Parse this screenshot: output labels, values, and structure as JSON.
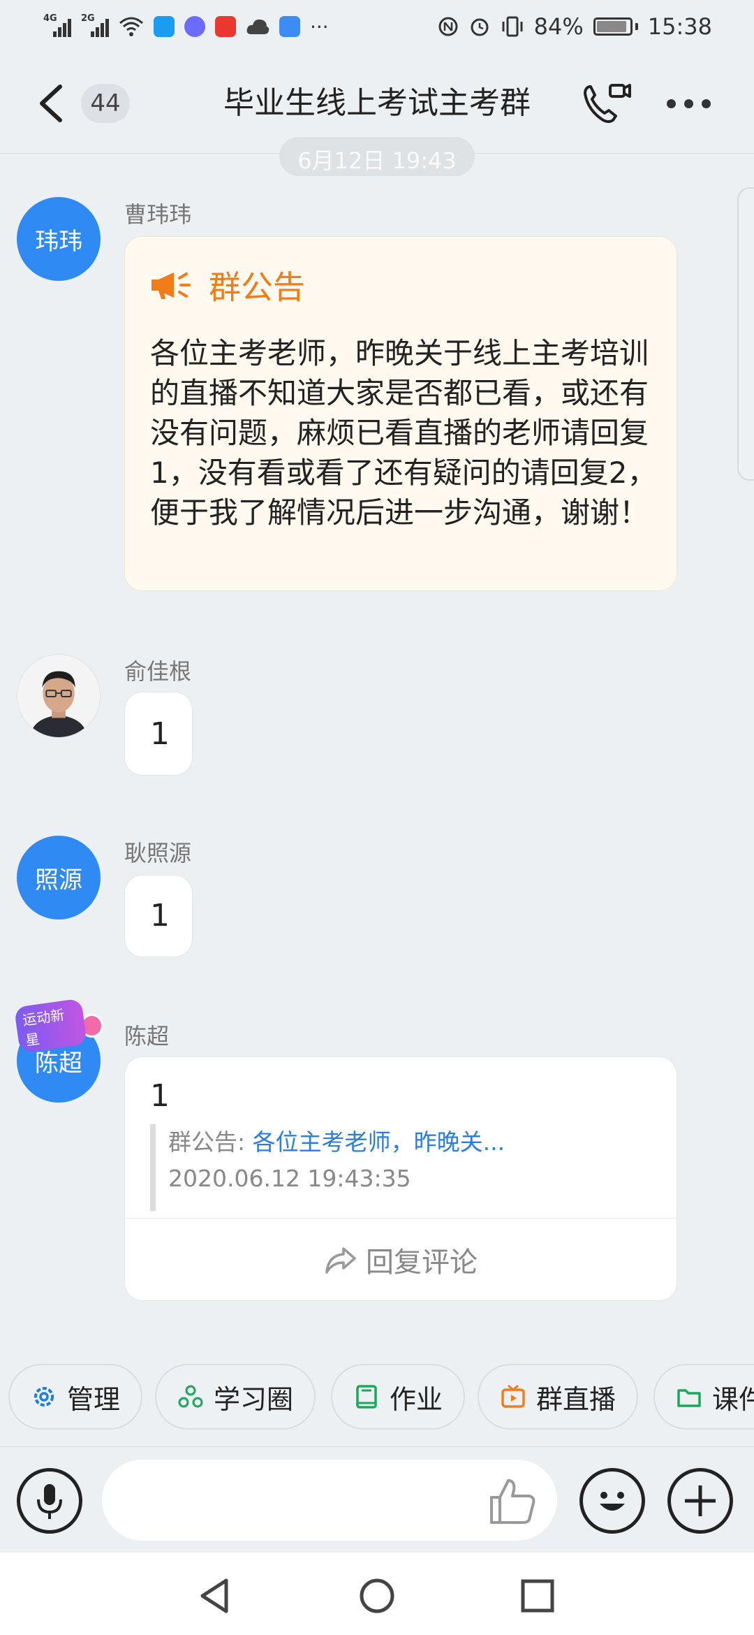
{
  "status_bar": {
    "net1": "4G",
    "net2": "2G",
    "battery": "84%",
    "time": "15:38",
    "extra": "···"
  },
  "header": {
    "back_icon": "chevron-left-icon",
    "unread_count": "44",
    "title": "毕业生线上考试主考群",
    "call_icon": "phone-video-icon",
    "more_icon": "more-dots-icon"
  },
  "time_divider": "6月12日 19:43",
  "messages": [
    {
      "avatar_text": "玮玮",
      "sender": "曹玮玮",
      "type": "notice",
      "notice_title": "群公告",
      "notice_icon": "megaphone-icon",
      "notice_body": "各位主考老师，昨晚关于线上主考培训的直播不知道大家是否都已看，或还有没有问题，麻烦已看直播的老师请回复1，没有看或看了还有疑问的请回复2，便于我了解情况后进一步沟通，谢谢！"
    },
    {
      "avatar_text": "",
      "sender": "俞佳根",
      "type": "text",
      "text": "1"
    },
    {
      "avatar_text": "照源",
      "sender": "耿照源",
      "type": "text",
      "text": "1"
    },
    {
      "avatar_text": "陈超",
      "avatar_tag": "运动新星",
      "sender": "陈超",
      "type": "reply",
      "text": "1",
      "quote_label": "群公告: ",
      "quote_link": "各位主考老师，昨晚关...",
      "quote_time": "2020.06.12 19:43:35",
      "reply_label": "回复评论"
    }
  ],
  "chips": [
    {
      "label": "管理",
      "icon": "gear-icon",
      "color": "#1a7fe0"
    },
    {
      "label": "学习圈",
      "icon": "circles-icon",
      "color": "#1aa85a"
    },
    {
      "label": "作业",
      "icon": "book-icon",
      "color": "#1aa85a"
    },
    {
      "label": "群直播",
      "icon": "tv-icon",
      "color": "#f07d1a"
    },
    {
      "label": "课件",
      "icon": "folder-icon",
      "color": "#1aa85a"
    }
  ],
  "input": {
    "placeholder": ""
  },
  "colors": {
    "accent_blue": "#2f8af3",
    "notice_orange": "#f07d1a",
    "link_blue": "#2a7de1",
    "background": "#edf0f3"
  }
}
